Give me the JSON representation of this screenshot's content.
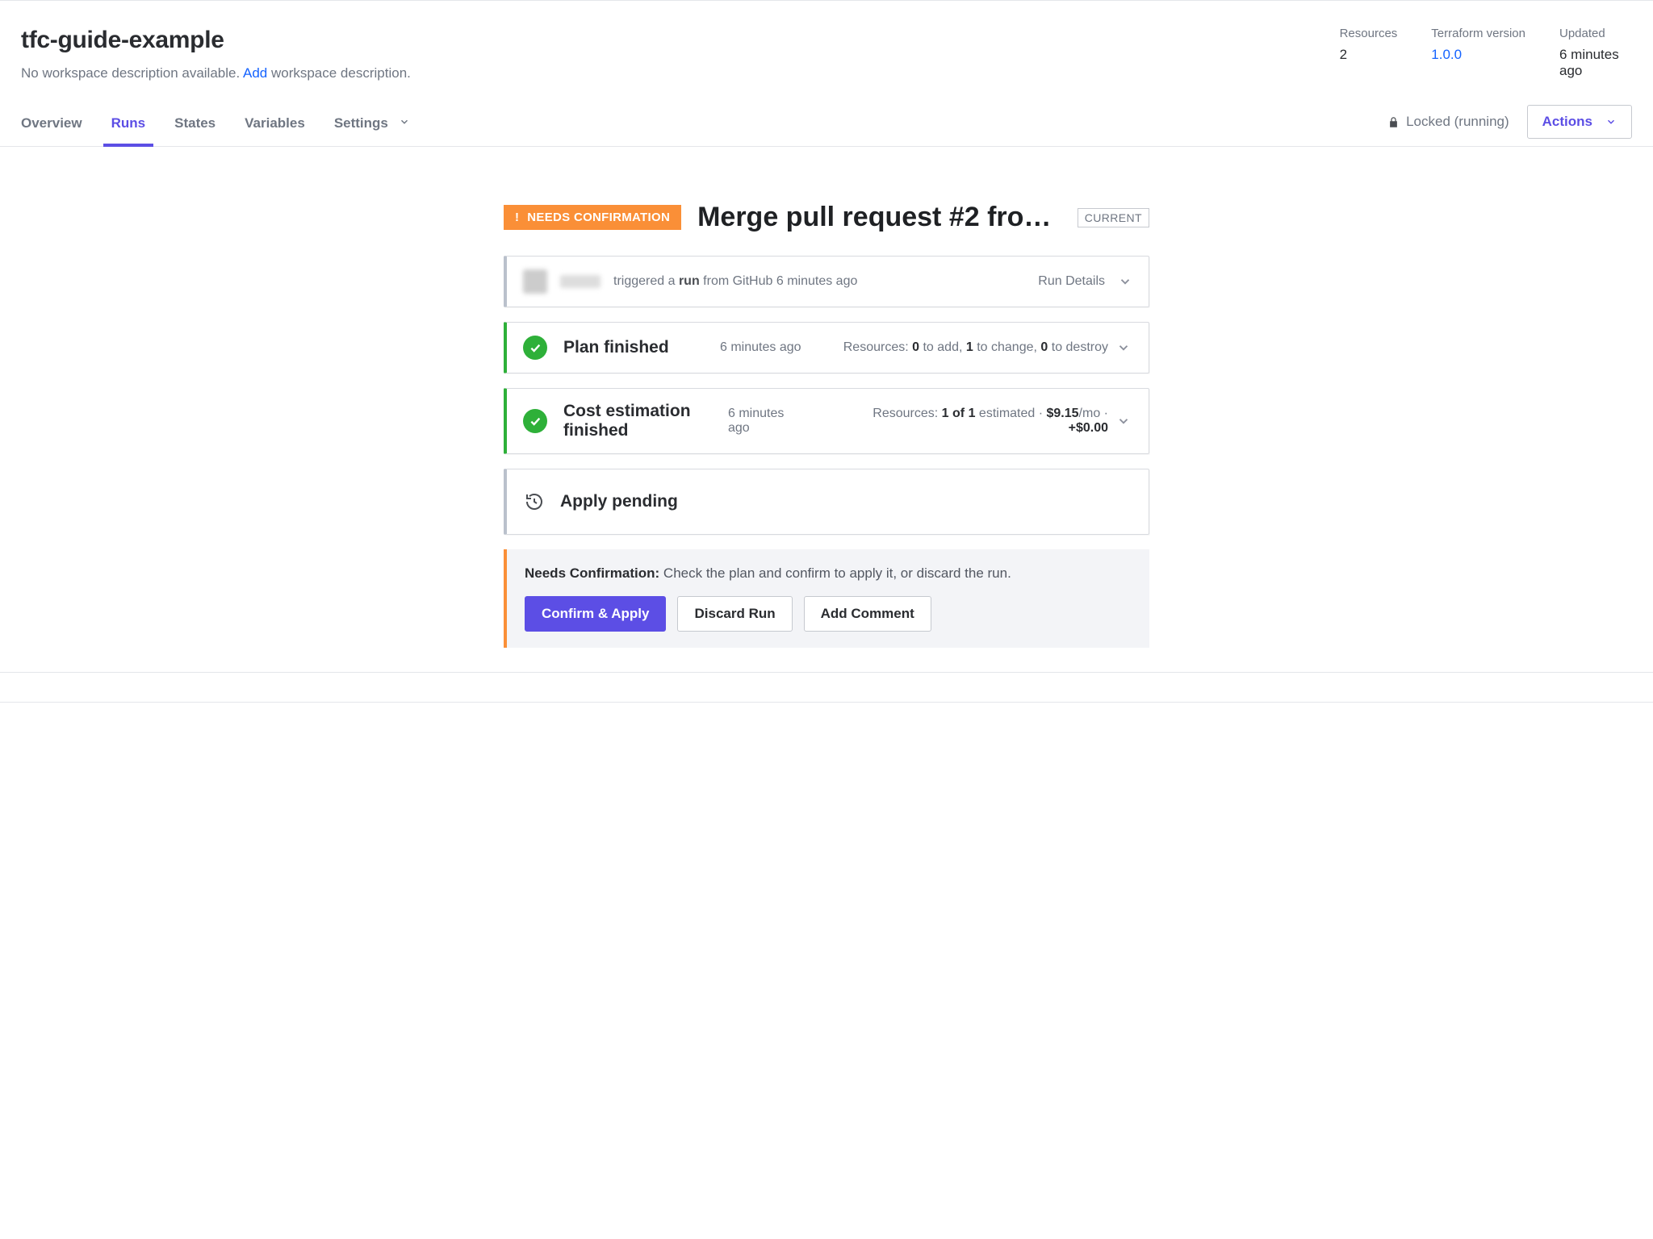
{
  "workspace": {
    "title": "tfc-guide-example",
    "desc_prefix": "No workspace description available. ",
    "desc_link": "Add",
    "desc_suffix": " workspace description."
  },
  "meta": {
    "resources_label": "Resources",
    "resources_value": "2",
    "tfv_label": "Terraform version",
    "tfv_value": "1.0.0",
    "updated_label": "Updated",
    "updated_value": "6 minutes ago"
  },
  "tabs": {
    "overview": "Overview",
    "runs": "Runs",
    "states": "States",
    "variables": "Variables",
    "settings": "Settings"
  },
  "locked_text": "Locked (running)",
  "actions_label": "Actions",
  "run": {
    "needs_badge": "NEEDS CONFIRMATION",
    "title": "Merge pull request #2 from …",
    "current_badge": "CURRENT"
  },
  "trigger": {
    "text_prefix": " triggered a ",
    "run_word": "run",
    "text_suffix": " from GitHub 6 minutes ago",
    "details_label": "Run Details"
  },
  "plan": {
    "title": "Plan finished",
    "time": "6 minutes ago",
    "res_prefix": "Resources: ",
    "to_add": "0",
    "add_suffix": " to add, ",
    "to_change": "1",
    "change_suffix": " to change, ",
    "to_destroy": "0",
    "destroy_suffix": " to destroy"
  },
  "cost": {
    "title": "Cost estimation finished",
    "time": "6 minutes ago",
    "res_prefix": "Resources: ",
    "est_count": "1 of 1",
    "est_suffix": " estimated · ",
    "price": "$9.15",
    "price_suffix": "/mo · ",
    "delta": "+$0.00"
  },
  "apply": {
    "title": "Apply pending"
  },
  "confirm": {
    "bold": "Needs Confirmation:",
    "text": " Check the plan and confirm to apply it, or discard the run.",
    "btn_confirm": "Confirm & Apply",
    "btn_discard": "Discard Run",
    "btn_comment": "Add Comment"
  }
}
